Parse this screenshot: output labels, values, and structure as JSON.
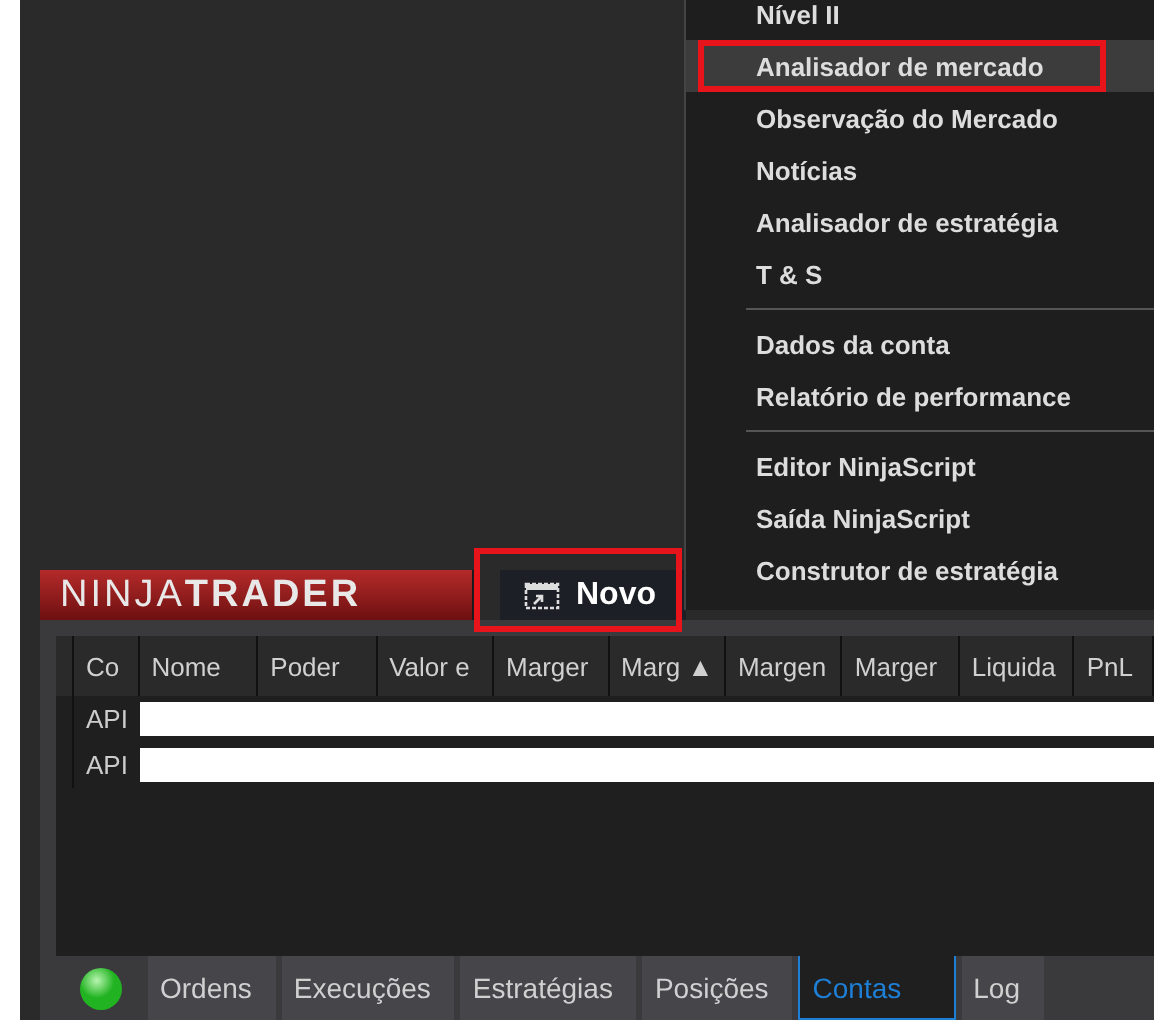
{
  "menu": {
    "items": [
      {
        "kind": "item",
        "label": "Nível II",
        "selected": false,
        "annotated": false
      },
      {
        "kind": "item",
        "label": "Analisador de mercado",
        "selected": true,
        "annotated": true
      },
      {
        "kind": "item",
        "label": "Observação do Mercado",
        "selected": false,
        "annotated": false
      },
      {
        "kind": "item",
        "label": "Notícias",
        "selected": false,
        "annotated": false
      },
      {
        "kind": "item",
        "label": "Analisador de estratégia",
        "selected": false,
        "annotated": false
      },
      {
        "kind": "item",
        "label": "T & S",
        "selected": false,
        "annotated": false
      },
      {
        "kind": "separator"
      },
      {
        "kind": "item",
        "label": "Dados da conta",
        "selected": false,
        "annotated": false
      },
      {
        "kind": "item",
        "label": "Relatório de performance",
        "selected": false,
        "annotated": false
      },
      {
        "kind": "separator"
      },
      {
        "kind": "item",
        "label": "Editor NinjaScript",
        "selected": false,
        "annotated": false
      },
      {
        "kind": "item",
        "label": "Saída NinjaScript",
        "selected": false,
        "annotated": false
      },
      {
        "kind": "item",
        "label": "Construtor de estratégia",
        "selected": false,
        "annotated": false
      }
    ]
  },
  "control_center": {
    "logo": "NINJA**TRADER**",
    "new_tab": {
      "label": "Novo",
      "annotated": true
    },
    "table": {
      "columns": [
        "Co",
        "Nome",
        "Poder",
        "Valor e",
        "Marger",
        "Marg ▲",
        "Margen",
        "Marger",
        "Liquida",
        "PnL"
      ],
      "rows": [
        {
          "column_1": "API"
        },
        {
          "column_1": "API"
        }
      ]
    },
    "connection": {
      "color": "#22b322"
    },
    "tabs": [
      {
        "label": "Ordens",
        "selected": false
      },
      {
        "label": "Execuções",
        "selected": false
      },
      {
        "label": "Estratégias",
        "selected": false
      },
      {
        "label": "Posições",
        "selected": false
      },
      {
        "label": "Contas",
        "selected": true
      },
      {
        "label": "Log",
        "selected": false
      }
    ]
  }
}
